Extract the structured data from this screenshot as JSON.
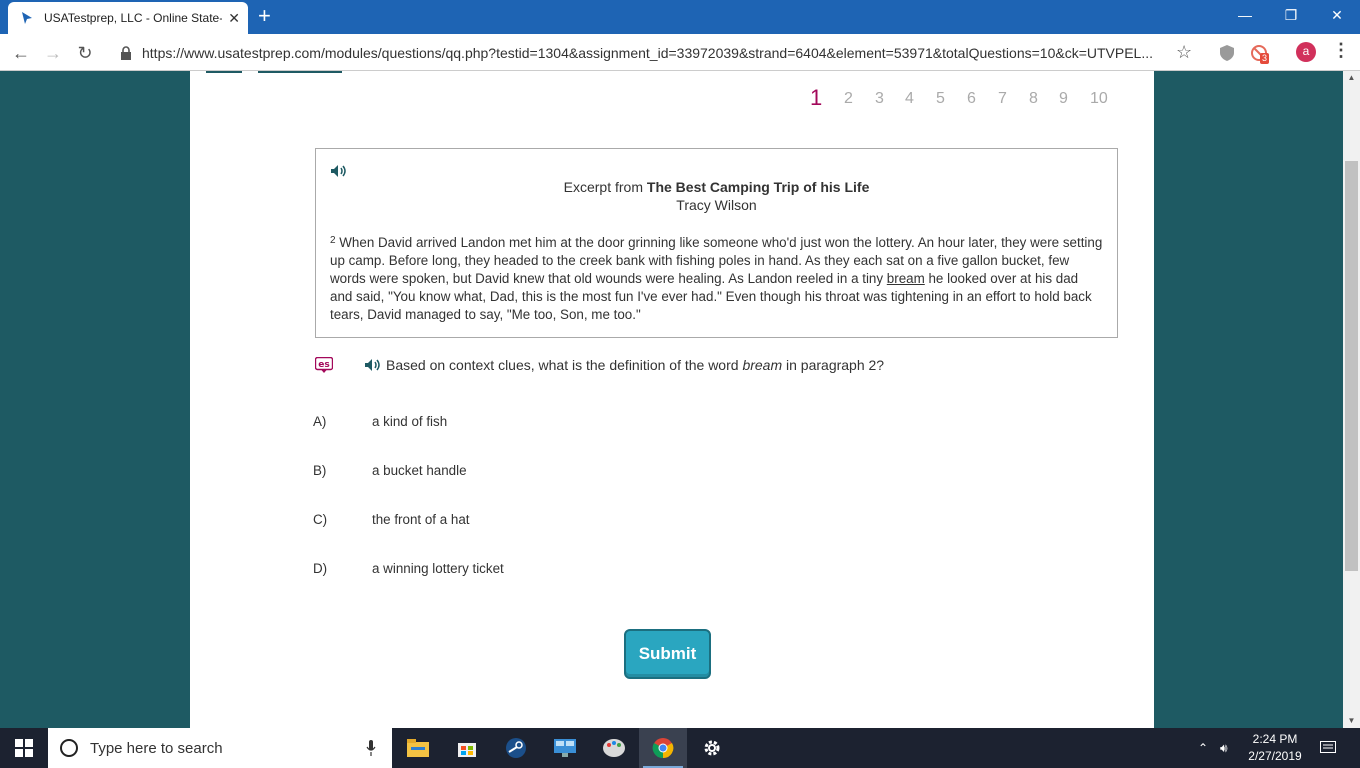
{
  "browser": {
    "tab_title": "USATestprep, LLC - Online State-",
    "url": "https://www.usatestprep.com/modules/questions/qq.php?testid=1304&assignment_id=33972039&strand=6404&element=53971&totalQuestions=10&ck=UTVPEL...",
    "extension_badge": "3",
    "profile_initial": "a"
  },
  "question_nav": {
    "numbers": [
      "1",
      "2",
      "3",
      "4",
      "5",
      "6",
      "7",
      "8",
      "9",
      "10"
    ],
    "active": "1"
  },
  "passage": {
    "excerpt_prefix": "Excerpt from",
    "title": "The Best Camping Trip of his Life",
    "author": "Tracy Wilson",
    "para_number": "2",
    "para_before": " When David arrived Landon met him at the door grinning like someone who'd just won the lottery. An hour later, they were setting up camp. Before long, they headed to the creek bank with fishing poles in hand. As they each sat on a five gallon bucket, few words were spoken, but David knew that old wounds were healing. As Landon reeled in a tiny ",
    "para_word": "bream",
    "para_after": " he looked over at his dad and said, \"You know what, Dad, this is the most fun I've ever had.\" Even though his throat was tightening in an effort to hold back tears, David managed to say, \"Me too, Son, me too.\""
  },
  "question": {
    "before": "Based on context clues, what is the definition of the word ",
    "word": "bream",
    "after": " in paragraph 2?"
  },
  "choices": [
    {
      "letter": "A)",
      "text": "a kind of fish"
    },
    {
      "letter": "B)",
      "text": "a bucket handle"
    },
    {
      "letter": "C)",
      "text": "the front of a hat"
    },
    {
      "letter": "D)",
      "text": "a winning lottery ticket"
    }
  ],
  "submit_label": "Submit",
  "taskbar": {
    "search_placeholder": "Type here to search",
    "time": "2:24 PM",
    "date": "2/27/2019"
  },
  "colors": {
    "accent": "#a3085a",
    "page_bg": "#1e5a63",
    "submit": "#2aa6c0",
    "titlebar": "#1e64b4"
  }
}
